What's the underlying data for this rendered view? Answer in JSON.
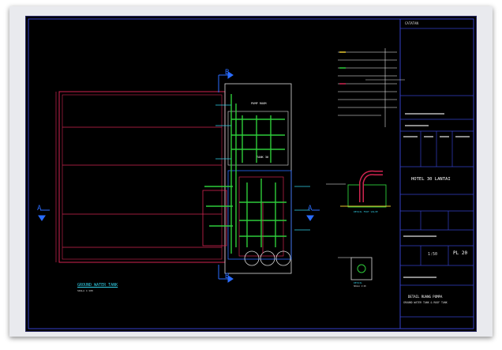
{
  "drawing": {
    "section_marks": {
      "a": "A",
      "b": "B"
    },
    "room_labels": {
      "pump_room": "PUMP ROOM",
      "tank": "TANK 30"
    },
    "plan_title": "GROUND WATER TANK",
    "plan_scale": "SKALA 1:100",
    "detail_1_label": "DETAIL FOOT VALVE",
    "detail_2_label": "DETAIL",
    "detail_2_sub": "SKALA 1:20"
  },
  "title_block": {
    "header": "CATATAN",
    "project": "HOTEL 30 LANTAI",
    "scale": "1:50",
    "sheet_no": "PL 20",
    "sheet_title_1": "DETAIL RUANG POMPA",
    "sheet_title_2": "GROUND WATER TANK & ROOF TANK"
  },
  "colors": {
    "sheet_bg": "#000000",
    "tank_outline": "#d02550",
    "pipe_green": "#2ecc3a",
    "section_blue": "#2a6cff",
    "annotation_white": "#ffffff",
    "border_blue": "#3340c8",
    "label_cyan": "#32d0e8"
  }
}
